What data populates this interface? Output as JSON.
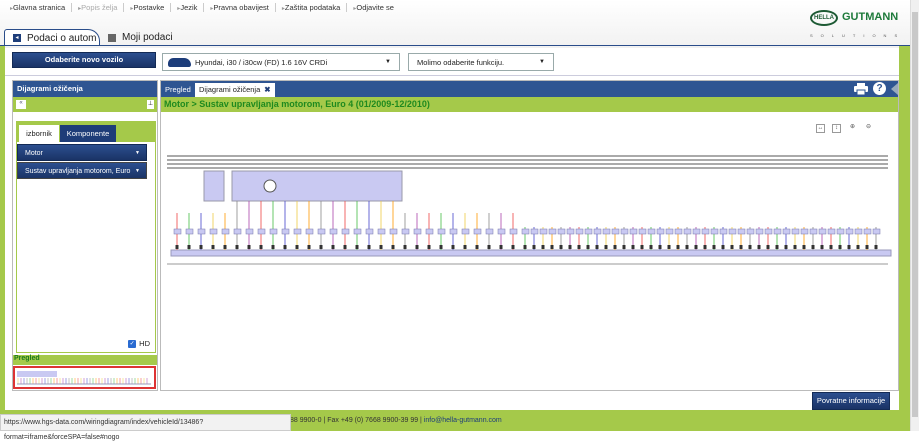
{
  "topnav": {
    "links": [
      "Glavna stranica",
      "Popis želja",
      "Postavke",
      "Jezik",
      "Pravna obavijest",
      "Zaštita podataka",
      "Odjavite se"
    ]
  },
  "logo": {
    "hella": "HELLA",
    "gutmann": "GUTMANN",
    "solutions": "SOLUTIONS"
  },
  "tabs": {
    "vehicle": "Podaci o automobilu",
    "mydata": "Moji podaci"
  },
  "vehicle_row": {
    "new_vehicle": "Odaberite novo vozilo",
    "vehicle": "Hyundai, i30 / i30cw (FD) 1.6 16V CRDi",
    "function_placeholder": "Molimo odaberite funkciju."
  },
  "left_panel": {
    "title": "Dijagrami ožičenja",
    "collapse": "«",
    "pin": "⊥",
    "tabs": [
      "izbornik",
      "Komponente"
    ],
    "menu": [
      "Motor",
      "Sustav upravljanja motorom, Euro"
    ],
    "hd_label": "HD",
    "preview_label": "Pregled"
  },
  "main_panel": {
    "tabs": [
      "Pregled",
      "Dijagrami ožičenja"
    ],
    "close": "✖",
    "help": "?",
    "breadcrumb": "Motor > Sustav upravljanja motorom, Euro 4 (01/2009-12/2010)"
  },
  "feedback": "Povratne informacije",
  "footer": {
    "text": "88 9900-0 | Fax +49 (0) 7668 9900-39 99 | ",
    "email": "info@hella-gutmann.com"
  },
  "status_url": "https://www.hgs-data.com/wiringdiagram/index/vehicleId/13486?format=iframe&forceSPA=false#nogo",
  "colors": {
    "brand_blue": "#2f5592",
    "brand_green": "#a5c94a",
    "breadcrumb_green": "#1f8a1f"
  }
}
